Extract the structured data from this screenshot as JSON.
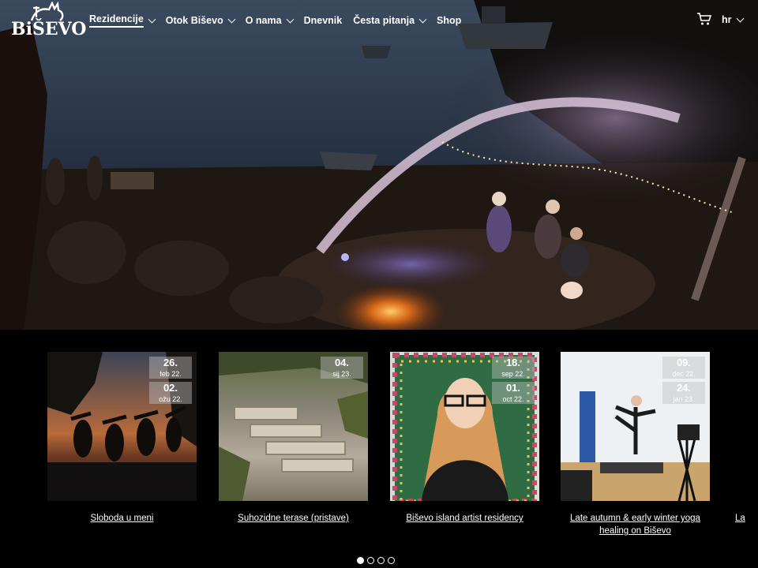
{
  "header": {
    "logo_text": "BiŠEVO",
    "nav": [
      {
        "label": "Rezidencije",
        "dropdown": true,
        "active": true
      },
      {
        "label": "Otok Biševo",
        "dropdown": true,
        "active": false
      },
      {
        "label": "O nama",
        "dropdown": true,
        "active": false
      },
      {
        "label": "Dnevnik",
        "dropdown": false,
        "active": false
      },
      {
        "label": "Česta pitanja",
        "dropdown": true,
        "active": false
      },
      {
        "label": "Shop",
        "dropdown": false,
        "active": false
      }
    ],
    "cart_icon": "cart-icon",
    "language": "hr"
  },
  "hero": {
    "scene": "night beach with musicians, string lights and campfire"
  },
  "cards": [
    {
      "title": "Sloboda u meni",
      "dates": [
        {
          "day": "26.",
          "month": "feb 22."
        },
        {
          "day": "02.",
          "month": "ožu 22."
        }
      ]
    },
    {
      "title": "Suhozidne terase (pristave)",
      "dates": [
        {
          "day": "04.",
          "month": "sij 23."
        }
      ]
    },
    {
      "title": "Biševo island artist residency",
      "dates": [
        {
          "day": "18.",
          "month": "sep 22."
        },
        {
          "day": "01.",
          "month": "oct 22."
        }
      ]
    },
    {
      "title": "Late autumn & early winter yoga healing on Biševo",
      "dates": [
        {
          "day": "09.",
          "month": "dec 22."
        },
        {
          "day": "24.",
          "month": "jan 23."
        }
      ]
    }
  ],
  "peek_card_title": "La",
  "pagination": {
    "count": 4,
    "active": 0
  },
  "colors": {
    "background": "#000000",
    "text": "#ffffff",
    "badge": "rgba(190,190,190,0.45)"
  }
}
